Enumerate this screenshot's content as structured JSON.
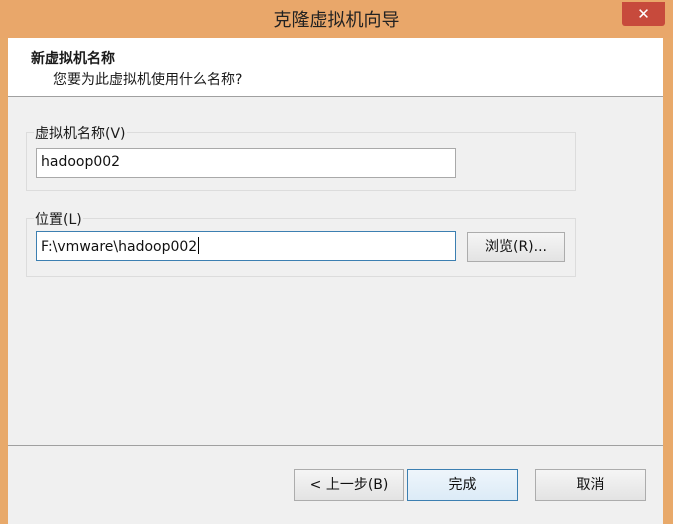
{
  "window": {
    "title": "克隆虚拟机向导",
    "close_glyph": "✕"
  },
  "header": {
    "title": "新虚拟机名称",
    "subtitle": "您要为此虚拟机使用什么名称?"
  },
  "name_group": {
    "label": "虚拟机名称(V)",
    "value": "hadoop002"
  },
  "location_group": {
    "label": "位置(L)",
    "value": "F:\\vmware\\hadoop002",
    "browse_label": "浏览(R)..."
  },
  "footer": {
    "back_label": "< 上一步(B)",
    "finish_label": "完成",
    "cancel_label": "取消"
  },
  "colors": {
    "title_bar": "#e9a76a",
    "close_button": "#c74a3c",
    "dialog_bg": "#f0f0f0",
    "focus_border": "#3c7fb1"
  }
}
